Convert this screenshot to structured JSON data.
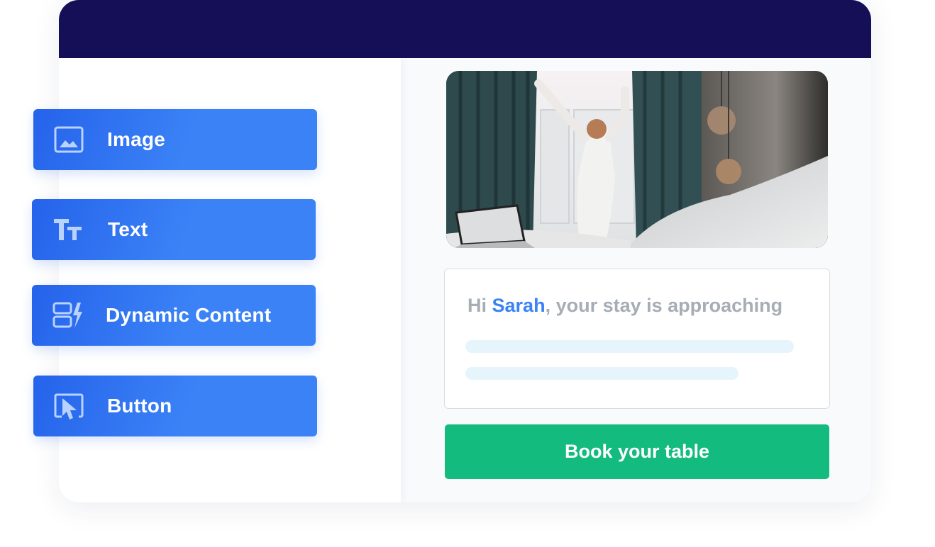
{
  "blocks": [
    {
      "label": "Image",
      "icon": "image-icon"
    },
    {
      "label": "Text",
      "icon": "text-size-icon"
    },
    {
      "label": "Dynamic Content",
      "icon": "dynamic-content-icon"
    },
    {
      "label": "Button",
      "icon": "cursor-click-icon"
    }
  ],
  "preview": {
    "greeting_prefix": "Hi ",
    "greeting_name": "Sarah",
    "greeting_suffix": ", your stay is approaching",
    "cta_label": "Book your table"
  },
  "colors": {
    "header": "#150f58",
    "block_blue": "#3b82f6",
    "name_accent": "#3b82f6",
    "cta_green": "#13bb7e"
  }
}
